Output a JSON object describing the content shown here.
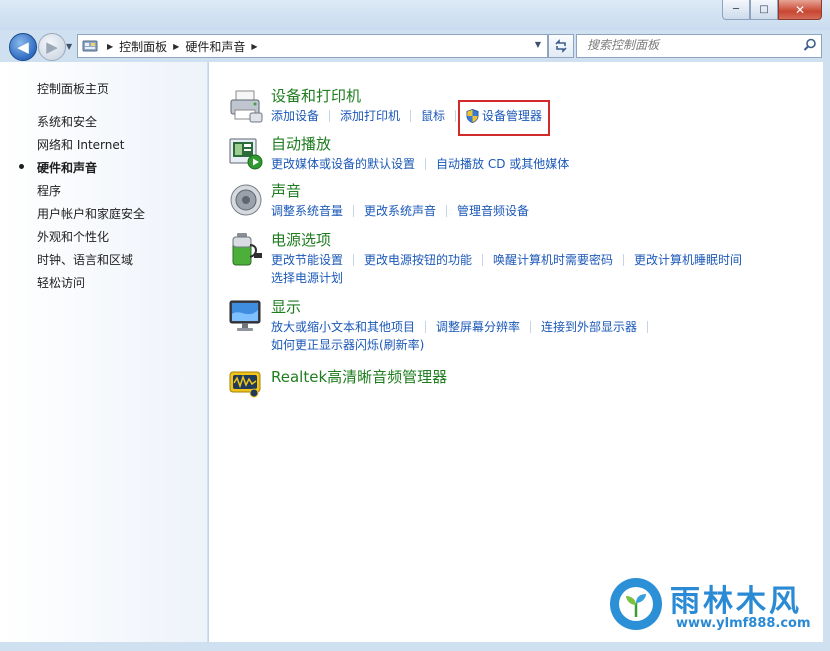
{
  "window": {
    "minimize_glyph": "─",
    "maximize_glyph": "□",
    "close_glyph": "✕"
  },
  "nav": {
    "back_glyph": "◀",
    "forward_glyph": "▶",
    "breadcrumb": [
      "控制面板",
      "硬件和声音"
    ],
    "search_placeholder": "搜索控制面板"
  },
  "sidebar": {
    "items": [
      {
        "label": "控制面板主页",
        "active": false
      },
      {
        "label": "系统和安全",
        "active": false
      },
      {
        "label": "网络和 Internet",
        "active": false
      },
      {
        "label": "硬件和声音",
        "active": true
      },
      {
        "label": "程序",
        "active": false
      },
      {
        "label": "用户帐户和家庭安全",
        "active": false
      },
      {
        "label": "外观和个性化",
        "active": false
      },
      {
        "label": "时钟、语言和区域",
        "active": false
      },
      {
        "label": "轻松访问",
        "active": false
      }
    ]
  },
  "categories": [
    {
      "title": "设备和打印机",
      "icon": "printer-icon",
      "links": [
        "添加设备",
        "添加打印机",
        "鼠标",
        "设备管理器"
      ],
      "highlighted_link": "设备管理器"
    },
    {
      "title": "自动播放",
      "icon": "autoplay-icon",
      "links": [
        "更改媒体或设备的默认设置",
        "自动播放 CD 或其他媒体"
      ]
    },
    {
      "title": "声音",
      "icon": "speaker-icon",
      "links": [
        "调整系统音量",
        "更改系统声音",
        "管理音频设备"
      ]
    },
    {
      "title": "电源选项",
      "icon": "battery-icon",
      "links": [
        "更改节能设置",
        "更改电源按钮的功能",
        "唤醒计算机时需要密码",
        "更改计算机睡眠时间",
        "选择电源计划"
      ]
    },
    {
      "title": "显示",
      "icon": "monitor-icon",
      "links": [
        "放大或缩小文本和其他项目",
        "调整屏幕分辨率",
        "连接到外部显示器",
        "如何更正显示器闪烁(刷新率)"
      ]
    },
    {
      "title": "Realtek高清晰音频管理器",
      "icon": "realtek-audio-icon",
      "links": []
    }
  ],
  "watermark": {
    "name": "雨林木风",
    "url": "www.ylmf888.com"
  },
  "colors": {
    "category_title": "#1f7c1f",
    "link": "#1b58b8",
    "highlight_box": "#d12b2b",
    "watermark": "#2a8ad3"
  }
}
